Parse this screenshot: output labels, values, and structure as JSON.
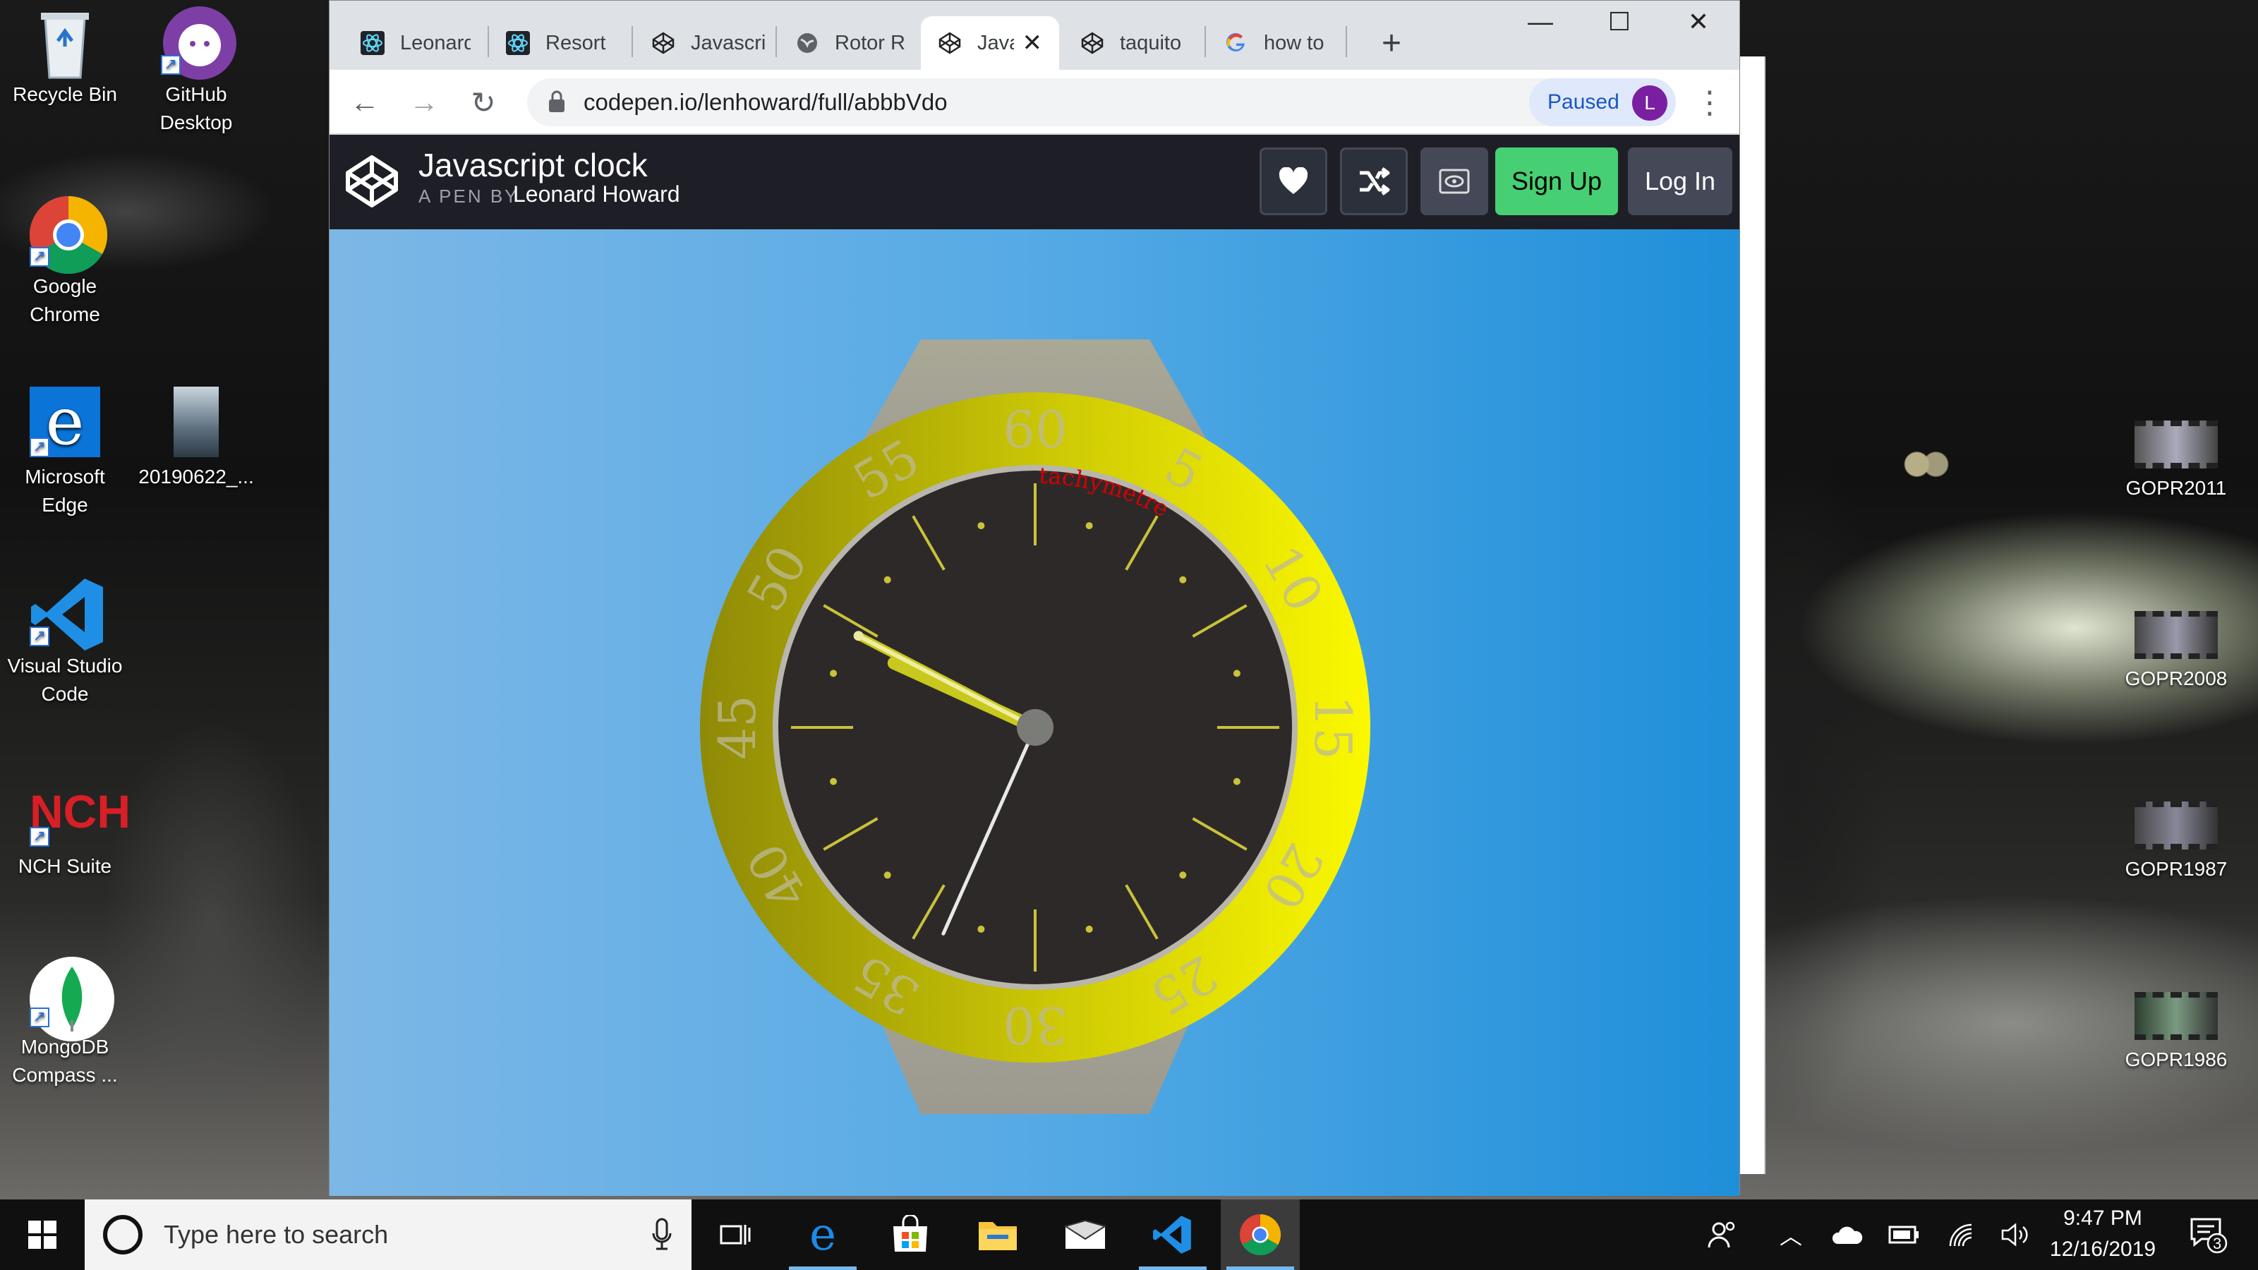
{
  "desktop": {
    "icons_left": [
      {
        "label": "Recycle Bin"
      },
      {
        "label": "GitHub Desktop"
      },
      {
        "label": "Google Chrome"
      },
      {
        "label": "Microsoft Edge"
      },
      {
        "label": "20190622_..."
      },
      {
        "label": "Visual Studio Code"
      },
      {
        "label": "NCH Suite"
      },
      {
        "label": "MongoDB Compass ..."
      }
    ],
    "icons_right": [
      {
        "label": "GOPR2011"
      },
      {
        "label": "GOPR2008"
      },
      {
        "label": "GOPR1987"
      },
      {
        "label": "GOPR1986"
      }
    ]
  },
  "browser": {
    "tabs": [
      {
        "label": "Leonard",
        "icon": "react-icon"
      },
      {
        "label": "Resort",
        "icon": "react-icon"
      },
      {
        "label": "Javascri",
        "icon": "codepen-icon"
      },
      {
        "label": "Rotor R",
        "icon": "globe-icon"
      },
      {
        "label": "Java",
        "icon": "codepen-icon",
        "active": true
      },
      {
        "label": "taquito",
        "icon": "codepen-icon"
      },
      {
        "label": "how to",
        "icon": "google-icon"
      }
    ],
    "url": "codepen.io/lenhoward/full/abbbVdo",
    "profile_status": "Paused",
    "profile_initial": "L"
  },
  "codepen": {
    "title": "Javascript clock",
    "by_label": "A PEN BY",
    "author": "Leonard Howard",
    "signup_label": "Sign Up",
    "login_label": "Log In"
  },
  "watch": {
    "bezel_numbers": [
      "60",
      "5",
      "10",
      "15",
      "20",
      "25",
      "30",
      "35",
      "40",
      "45",
      "50",
      "55"
    ],
    "dial_text": "tachymetre",
    "time": {
      "hour": 9,
      "minute": 49,
      "second": 34
    },
    "colors": {
      "bezel_light": "#f8f500",
      "bezel_dark": "#8f8a07",
      "dial": "#2d2828",
      "hands": "#c8c81e",
      "strap": "#a9a79b"
    }
  },
  "taskbar": {
    "search_placeholder": "Type here to search",
    "time": "9:47 PM",
    "date": "12/16/2019",
    "notification_count": "3"
  }
}
